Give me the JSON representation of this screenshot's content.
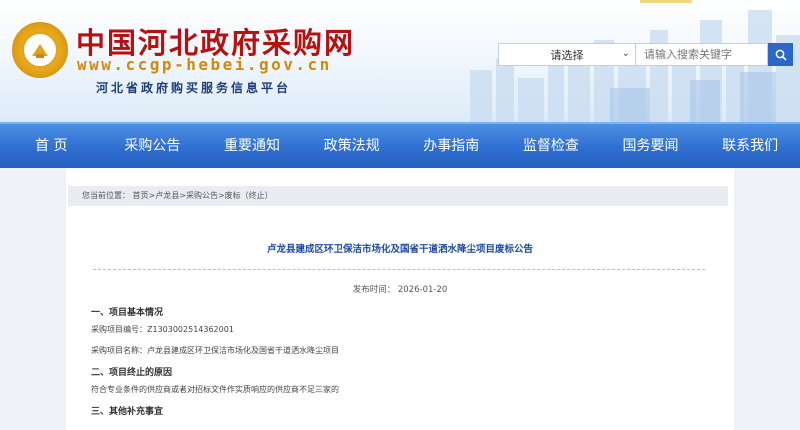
{
  "header": {
    "title": "中国河北政府采购网",
    "url": "www.ccgp-hebei.gov.cn",
    "subtitle": "河北省政府购买服务信息平台"
  },
  "search": {
    "select_value": "请选择",
    "placeholder": "请输入搜索关键字"
  },
  "nav": {
    "items": [
      "首 页",
      "采购公告",
      "重要通知",
      "政策法规",
      "办事指南",
      "监督检查",
      "国务要闻",
      "联系我们"
    ]
  },
  "breadcrumb": {
    "prefix": "您当前位置：",
    "items": [
      "首页",
      "卢龙县",
      "采购公告",
      "废标（终止）"
    ],
    "sep": ">"
  },
  "article": {
    "title": "卢龙县建成区环卫保洁市场化及国省干道洒水降尘项目废标公告",
    "pub_date": "发布时间： 2026-01-20",
    "sections": [
      {
        "heading": "一、项目基本情况"
      },
      {
        "heading": "二、项目终止的原因"
      },
      {
        "heading": "三、其他补充事宜"
      }
    ],
    "project_code": "采购项目编号：Z1303002514362001",
    "project_name": "采购项目名称：卢龙县建成区环卫保洁市场化及国省干道洒水降尘项目",
    "reason": "符合专业条件的供应商或者对招标文件作实质响应的供应商不足三家的"
  },
  "colors": {
    "title_red": "#b31212",
    "url_orange": "#d08a0c",
    "nav_blue": "#2f6fd0",
    "link_blue": "#1e4ba0"
  }
}
